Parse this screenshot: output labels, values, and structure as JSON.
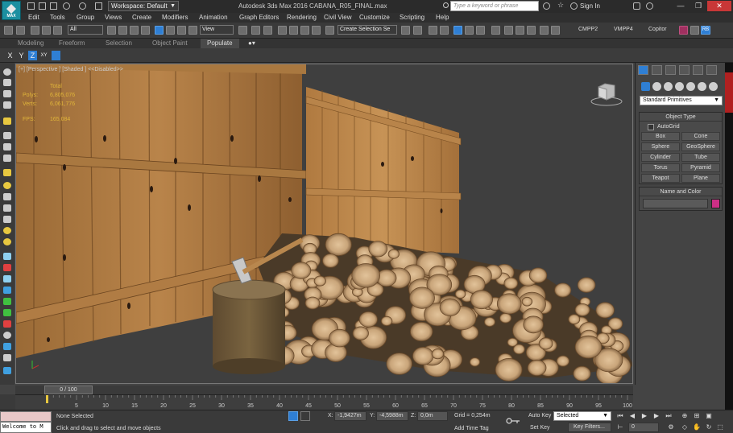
{
  "app": {
    "title": "Autodesk 3ds Max 2016    CABANA_R05_FINAL.max",
    "logo_text": "MAX",
    "workspace": "Workspace: Default",
    "search_placeholder": "Type a keyword or phrase",
    "signin": "Sign In",
    "window_controls": {
      "minimize": "—",
      "maximize": "❐",
      "close": "✕"
    }
  },
  "menu": [
    "Edit",
    "Tools",
    "Group",
    "Views",
    "Create",
    "Modifiers",
    "Animation",
    "Graph Editors",
    "Rendering",
    "Civil View",
    "Customize",
    "Scripting",
    "Help"
  ],
  "toolbar": {
    "selection_filter": "All",
    "ref_coord": "View",
    "named_selection": "Create Selection Se",
    "custom_labels": [
      "CMPP2",
      "VMPP4",
      "Copitor"
    ],
    "badge": "RB"
  },
  "ribbon_tabs": [
    "Modeling",
    "Freeform",
    "Selection",
    "Object Paint",
    "Populate"
  ],
  "axis": {
    "x": "X",
    "y": "Y",
    "z": "Z",
    "xy": "XY"
  },
  "viewport": {
    "label": "[+] [Perspective ] [Shaded ] <<Disabled>>",
    "stats_header": "Total",
    "stats": [
      {
        "label": "Polys:",
        "value": "6,805,076"
      },
      {
        "label": "Verts:",
        "value": "6,061,776"
      }
    ],
    "fps_label": "FPS:",
    "fps_value": "165,084"
  },
  "command_panel": {
    "category": "Standard Primitives",
    "object_type_header": "Object Type",
    "autogrid_label": "AutoGrid",
    "object_buttons": [
      "Box",
      "Cone",
      "Sphere",
      "GeoSphere",
      "Cylinder",
      "Tube",
      "Torus",
      "Pyramid",
      "Teapot",
      "Plane"
    ],
    "name_color_header": "Name and Color",
    "object_color": "#cc2f86"
  },
  "timeline": {
    "slider_label": "0 / 100",
    "ticks": [
      "5",
      "10",
      "15",
      "20",
      "25",
      "30",
      "35",
      "40",
      "45",
      "50",
      "55",
      "60",
      "65",
      "70",
      "75",
      "80",
      "85",
      "90",
      "95",
      "100"
    ]
  },
  "status": {
    "listener_text": "Welcome to M",
    "selection": "None Selected",
    "prompt": "Click and drag to select and move objects",
    "x_label": "X:",
    "x_value": "-1,9427m",
    "y_label": "Y:",
    "y_value": "-4,5988m",
    "z_label": "Z:",
    "z_value": "0,0m",
    "grid": "Grid = 0,254m",
    "add_time_tag": "Add Time Tag",
    "auto_key": "Auto Key",
    "set_key": "Set Key",
    "key_mode": "Selected",
    "key_filters": "Key Filters...",
    "current_frame": "0"
  }
}
